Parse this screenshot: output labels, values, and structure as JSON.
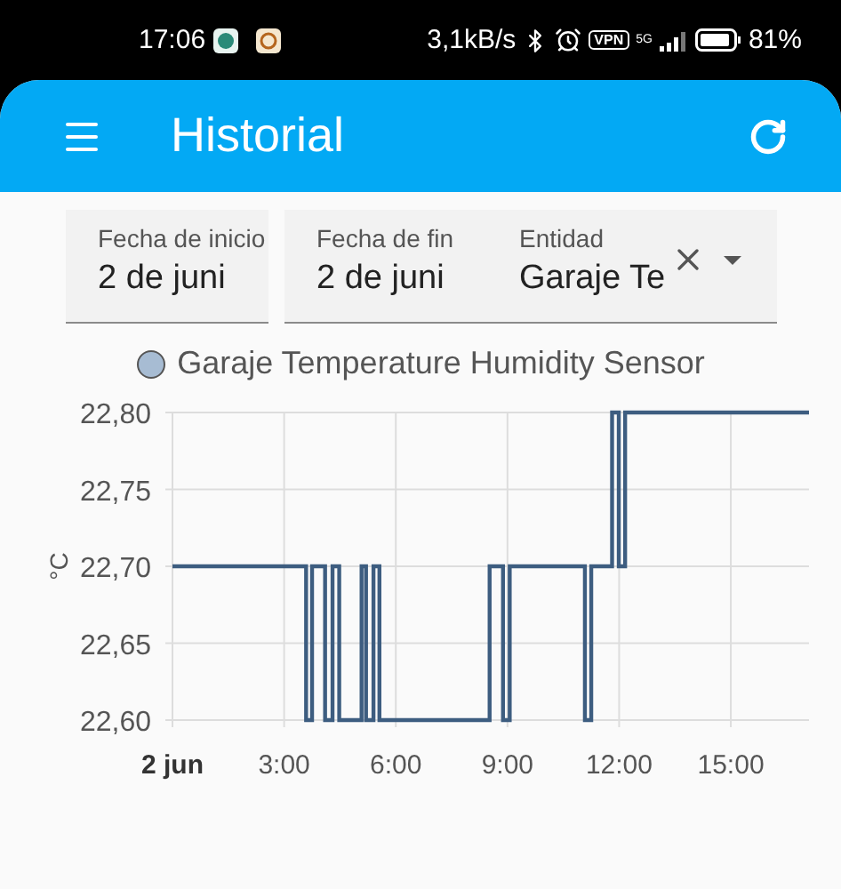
{
  "status_bar": {
    "time": "17:06",
    "network_speed": "3,1kB/s",
    "vpn_label": "VPN",
    "network_type": "5G",
    "battery": "81%"
  },
  "app_bar": {
    "title": "Historial"
  },
  "filters": [
    {
      "kind": "date",
      "label": "Fecha de inicio",
      "value": "2 de juni"
    },
    {
      "kind": "date",
      "label": "Fecha de fin",
      "value": "2 de juni"
    },
    {
      "kind": "select",
      "label": "Entidad",
      "value": "Garaje Te"
    }
  ],
  "chart": {
    "legend": [
      {
        "color": "#a7bcd3"
      }
    ],
    "chart_data": {
      "type": "line",
      "grid": true,
      "ylabel": "°C",
      "x": [
        0,
        3.59,
        3.59,
        3.75,
        3.75,
        4.1,
        4.1,
        4.3,
        4.3,
        4.48,
        4.48,
        5.08,
        5.08,
        5.2,
        5.2,
        5.4,
        5.4,
        5.56,
        5.56,
        8.52,
        8.52,
        8.88,
        8.88,
        9.06,
        9.06,
        11.08,
        11.08,
        11.25,
        11.25,
        11.81,
        11.81,
        11.99,
        11.99,
        12.16,
        12.16,
        17.1
      ],
      "series": [
        {
          "name": "Garaje Temperature Humidity Sensor",
          "color": "#3d5d80",
          "values": [
            22.7,
            22.7,
            22.6,
            22.6,
            22.7,
            22.7,
            22.6,
            22.6,
            22.7,
            22.7,
            22.6,
            22.6,
            22.7,
            22.7,
            22.6,
            22.6,
            22.7,
            22.7,
            22.6,
            22.6,
            22.7,
            22.7,
            22.6,
            22.6,
            22.7,
            22.7,
            22.6,
            22.6,
            22.7,
            22.7,
            22.8,
            22.8,
            22.7,
            22.7,
            22.8,
            22.8
          ]
        }
      ],
      "xlim": [
        0,
        17.1
      ],
      "ylim": [
        22.6,
        22.8
      ],
      "xticks": [
        {
          "value": 0,
          "label": "2 jun"
        },
        {
          "value": 3,
          "label": "3:00"
        },
        {
          "value": 6,
          "label": "6:00"
        },
        {
          "value": 9,
          "label": "9:00"
        },
        {
          "value": 12,
          "label": "12:00"
        },
        {
          "value": 15,
          "label": "15:00"
        }
      ],
      "yticks": [
        {
          "value": 22.6,
          "label": "22,60"
        },
        {
          "value": 22.65,
          "label": "22,65"
        },
        {
          "value": 22.7,
          "label": "22,70"
        },
        {
          "value": 22.75,
          "label": "22,75"
        },
        {
          "value": 22.8,
          "label": "22,80"
        }
      ]
    }
  }
}
